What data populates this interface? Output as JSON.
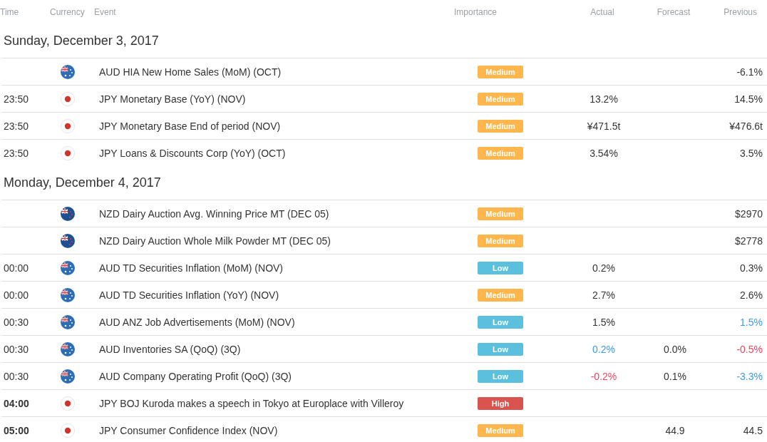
{
  "columns": [
    "Time",
    "Currency",
    "Event",
    "Importance",
    "Actual",
    "Forecast",
    "Previous"
  ],
  "days": [
    {
      "title": "Sunday, December 3, 2017",
      "events": [
        {
          "kind": "au",
          "event": "AUD HIA New Home Sales (MoM) (OCT)",
          "importance": {
            "label": "Medium",
            "kind": "medium"
          },
          "previous": {
            "text": "-6.1%"
          }
        },
        {
          "time": "23:50",
          "bold": false,
          "kind": "jp",
          "event": "JPY Monetary Base (YoY) (NOV)",
          "importance": {
            "label": "Medium",
            "kind": "medium"
          },
          "actual": {
            "text": "13.2%"
          },
          "previous": {
            "text": "14.5%"
          }
        },
        {
          "time": "23:50",
          "bold": false,
          "kind": "jp",
          "event": "JPY Monetary Base End of period (NOV)",
          "importance": {
            "label": "Medium",
            "kind": "medium"
          },
          "actual": {
            "text": "¥471.5t"
          },
          "previous": {
            "text": "¥476.6t"
          }
        },
        {
          "time": "23:50",
          "bold": false,
          "kind": "jp",
          "event": "JPY Loans & Discounts Corp (YoY) (OCT)",
          "importance": {
            "label": "Medium",
            "kind": "medium"
          },
          "actual": {
            "text": "3.54%"
          },
          "previous": {
            "text": "3.5%"
          }
        }
      ]
    },
    {
      "title": "Monday, December 4, 2017",
      "events": [
        {
          "kind": "nz",
          "event": "NZD Dairy Auction Avg. Winning Price MT (DEC 05)",
          "importance": {
            "label": "Medium",
            "kind": "medium"
          },
          "previous": {
            "text": "$2970"
          }
        },
        {
          "kind": "nz",
          "event": "NZD Dairy Auction Whole Milk Powder MT (DEC 05)",
          "importance": {
            "label": "Medium",
            "kind": "medium"
          },
          "previous": {
            "text": "$2778"
          }
        },
        {
          "time": "00:00",
          "bold": false,
          "kind": "au",
          "event": "AUD TD Securities Inflation (MoM) (NOV)",
          "importance": {
            "label": "Low",
            "kind": "low"
          },
          "actual": {
            "text": "0.2%"
          },
          "previous": {
            "text": "0.3%"
          }
        },
        {
          "time": "00:00",
          "bold": false,
          "kind": "au",
          "event": "AUD TD Securities Inflation (YoY) (NOV)",
          "importance": {
            "label": "Medium",
            "kind": "medium"
          },
          "actual": {
            "text": "2.7%"
          },
          "previous": {
            "text": "2.6%"
          }
        },
        {
          "time": "00:30",
          "bold": false,
          "kind": "au",
          "event": "AUD ANZ Job Advertisements (MoM) (NOV)",
          "importance": {
            "label": "Low",
            "kind": "low"
          },
          "actual": {
            "text": "1.5%"
          },
          "previous": {
            "text": "1.5%",
            "color": "#3d9be9"
          }
        },
        {
          "time": "00:30",
          "bold": false,
          "kind": "au",
          "event": "AUD Inventories SA (QoQ) (3Q)",
          "importance": {
            "label": "Low",
            "kind": "low"
          },
          "actual": {
            "text": "0.2%",
            "color": "#3d9be9"
          },
          "forecast": {
            "text": "0.0%"
          },
          "previous": {
            "text": "-0.5%",
            "color": "#f0445e"
          }
        },
        {
          "time": "00:30",
          "bold": false,
          "kind": "au",
          "event": "AUD Company Operating Profit (QoQ) (3Q)",
          "importance": {
            "label": "Low",
            "kind": "low"
          },
          "actual": {
            "text": "-0.2%",
            "color": "#f0445e"
          },
          "forecast": {
            "text": "0.1%"
          },
          "previous": {
            "text": "-3.3%",
            "color": "#3d9be9"
          }
        },
        {
          "time": "04:00",
          "bold": true,
          "kind": "jp",
          "event": "JPY BOJ Kuroda makes a speech in Tokyo at Europlace with Villeroy",
          "importance": {
            "label": "High",
            "kind": "high"
          }
        },
        {
          "time": "05:00",
          "bold": true,
          "kind": "jp",
          "event": "JPY Consumer Confidence Index (NOV)",
          "importance": {
            "label": "Medium",
            "kind": "medium"
          },
          "forecast": {
            "text": "44.9"
          },
          "previous": {
            "text": "44.5"
          }
        }
      ]
    }
  ]
}
